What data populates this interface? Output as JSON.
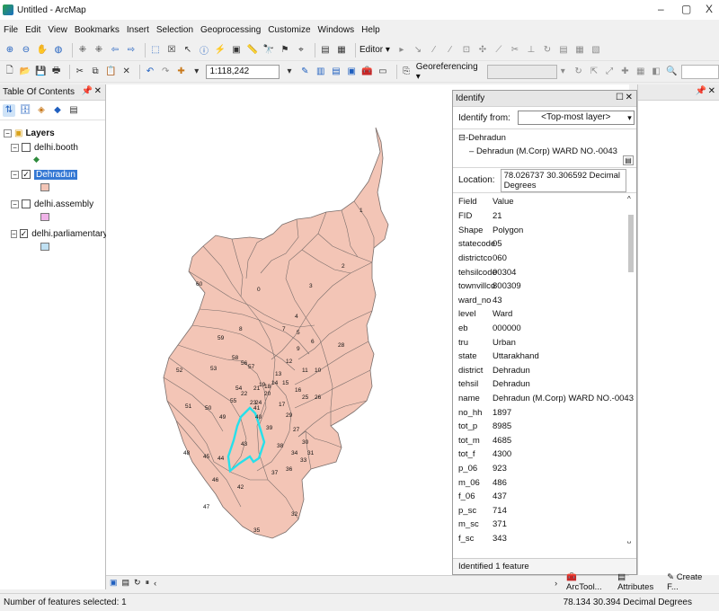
{
  "window": {
    "title": "Untitled - ArcMap",
    "minimize": "–",
    "restore": "▢",
    "close": "X"
  },
  "menus": [
    "File",
    "Edit",
    "View",
    "Bookmarks",
    "Insert",
    "Selection",
    "Geoprocessing",
    "Customize",
    "Windows",
    "Help"
  ],
  "toolbar": {
    "editor_label": "Editor ▾",
    "scale": "1:118,242",
    "georef_label": "Georeferencing ▾"
  },
  "toc": {
    "title": "Table Of Contents",
    "root": "Layers",
    "layers": [
      {
        "name": "delhi.booth",
        "checked": false,
        "selected": false,
        "swatch": "diamond",
        "color": "#2e8b3c"
      },
      {
        "name": "Dehradun",
        "checked": true,
        "selected": true,
        "swatch": "rect",
        "color": "#f3c5b6"
      },
      {
        "name": "delhi.assembly",
        "checked": false,
        "selected": false,
        "swatch": "rect",
        "color": "#f0b3e8"
      },
      {
        "name": "delhi.parliamentary",
        "checked": true,
        "selected": false,
        "swatch": "rect",
        "color": "#bfe0f2"
      }
    ]
  },
  "map": {
    "fill": "#f3c5b6",
    "stroke": "#7a6e6b",
    "highlight": "#27e0ea",
    "ward_labels": [
      "1",
      "2",
      "3",
      "4",
      "5",
      "6",
      "7",
      "8",
      "9",
      "10",
      "11",
      "12",
      "13",
      "14",
      "15",
      "16",
      "17",
      "18",
      "19",
      "20",
      "21",
      "22",
      "23",
      "24",
      "25",
      "26",
      "27",
      "28",
      "29",
      "30",
      "31",
      "32",
      "33",
      "34",
      "35",
      "36",
      "37",
      "38",
      "39",
      "40",
      "41",
      "42",
      "43",
      "44",
      "45",
      "46",
      "47",
      "48",
      "49",
      "50",
      "51",
      "52",
      "53",
      "54",
      "55",
      "56",
      "57",
      "58",
      "59",
      "60",
      "0"
    ]
  },
  "identify": {
    "title": "Identify",
    "from_label": "Identify from:",
    "from_value": "<Top-most layer>",
    "tree_root": "Dehradun",
    "tree_child": "Dehradun (M.Corp) WARD NO.-0043",
    "location_label": "Location:",
    "location_value": "78.026737  30.306592 Decimal Degrees",
    "header": {
      "field": "Field",
      "value": "Value"
    },
    "rows": [
      {
        "f": "FID",
        "v": "21"
      },
      {
        "f": "Shape",
        "v": "Polygon"
      },
      {
        "f": "statecode",
        "v": "05"
      },
      {
        "f": "districtco",
        "v": "060"
      },
      {
        "f": "tehsilcode",
        "v": "00304"
      },
      {
        "f": "townvillco",
        "v": "800309"
      },
      {
        "f": "ward_no",
        "v": "43"
      },
      {
        "f": "level",
        "v": "Ward"
      },
      {
        "f": "eb",
        "v": "000000"
      },
      {
        "f": "tru",
        "v": "Urban"
      },
      {
        "f": "state",
        "v": "Uttarakhand"
      },
      {
        "f": "district",
        "v": "Dehradun"
      },
      {
        "f": "tehsil",
        "v": "Dehradun"
      },
      {
        "f": "name",
        "v": "Dehradun (M.Corp) WARD NO.-0043"
      },
      {
        "f": "no_hh",
        "v": "1897"
      },
      {
        "f": "tot_p",
        "v": "8985"
      },
      {
        "f": "tot_m",
        "v": "4685"
      },
      {
        "f": "tot_f",
        "v": "4300"
      },
      {
        "f": "p_06",
        "v": "923"
      },
      {
        "f": "m_06",
        "v": "486"
      },
      {
        "f": "f_06",
        "v": "437"
      },
      {
        "f": "p_sc",
        "v": "714"
      },
      {
        "f": "m_sc",
        "v": "371"
      },
      {
        "f": "f_sc",
        "v": "343"
      }
    ],
    "status": "Identified 1 feature"
  },
  "dock_tabs": [
    "ArcTool...",
    "Attributes",
    "Create F..."
  ],
  "status": {
    "left": "Number of features selected: 1",
    "coords": "78.134  30.394 Decimal Degrees"
  }
}
